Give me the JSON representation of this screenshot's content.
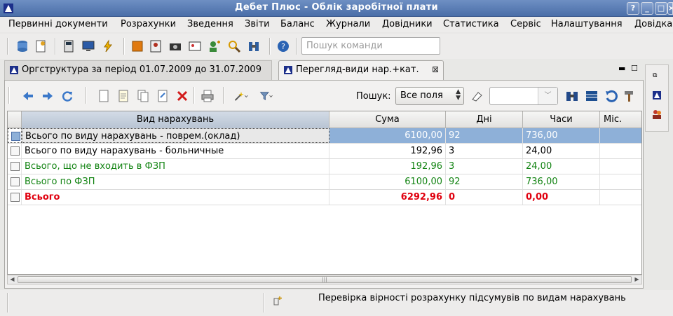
{
  "window": {
    "title": "Дебет Плюс - Облік заробітної плати"
  },
  "menu": [
    "Первинні документи",
    "Розрахунки",
    "Зведення",
    "Звіти",
    "Баланс",
    "Журнали",
    "Довідники",
    "Статистика",
    "Сервіс",
    "Налаштування",
    "Довідка"
  ],
  "toolbar": {
    "command_search_placeholder": "Пошук команди"
  },
  "tabs": [
    {
      "label": "Оргструктура за період 01.07.2009 до 31.07.2009",
      "active": false
    },
    {
      "label": "Перегляд-види нар.+кат.",
      "active": true,
      "close": "⊠"
    }
  ],
  "inner_toolbar": {
    "search_label": "Пошук:",
    "search_scope": "Все поля",
    "search_value": ""
  },
  "table": {
    "columns": [
      "Вид нарахувань",
      "Сума",
      "Дні",
      "Часи",
      "Міс."
    ],
    "rows": [
      {
        "name": "Всього по виду нарахувань -  поврем.(оклад)",
        "sum": "6100,00",
        "days": "92",
        "hours": "736,00",
        "months": "",
        "style": "selected"
      },
      {
        "name": "Всього по виду нарахувань -  больничные",
        "sum": "192,96",
        "days": "3",
        "hours": "24,00",
        "months": "",
        "style": "normal"
      },
      {
        "name": "Всього, що не входить в ФЗП",
        "sum": "192,96",
        "days": "3",
        "hours": "24,00",
        "months": "",
        "style": "green"
      },
      {
        "name": "Всього по ФЗП",
        "sum": "6100,00",
        "days": "92",
        "hours": "736,00",
        "months": "",
        "style": "green"
      },
      {
        "name": "Всього",
        "sum": "6292,96",
        "days": "0",
        "hours": "0,00",
        "months": "",
        "style": "red"
      }
    ]
  },
  "status": {
    "message": "Перевірка вірності розрахунку підсумувів по видам нарахувань"
  },
  "colors": {
    "title_bar": "#5a7db6",
    "selection": "#8eb0d8",
    "green_text": "#138413",
    "red_text": "#e0000f"
  }
}
